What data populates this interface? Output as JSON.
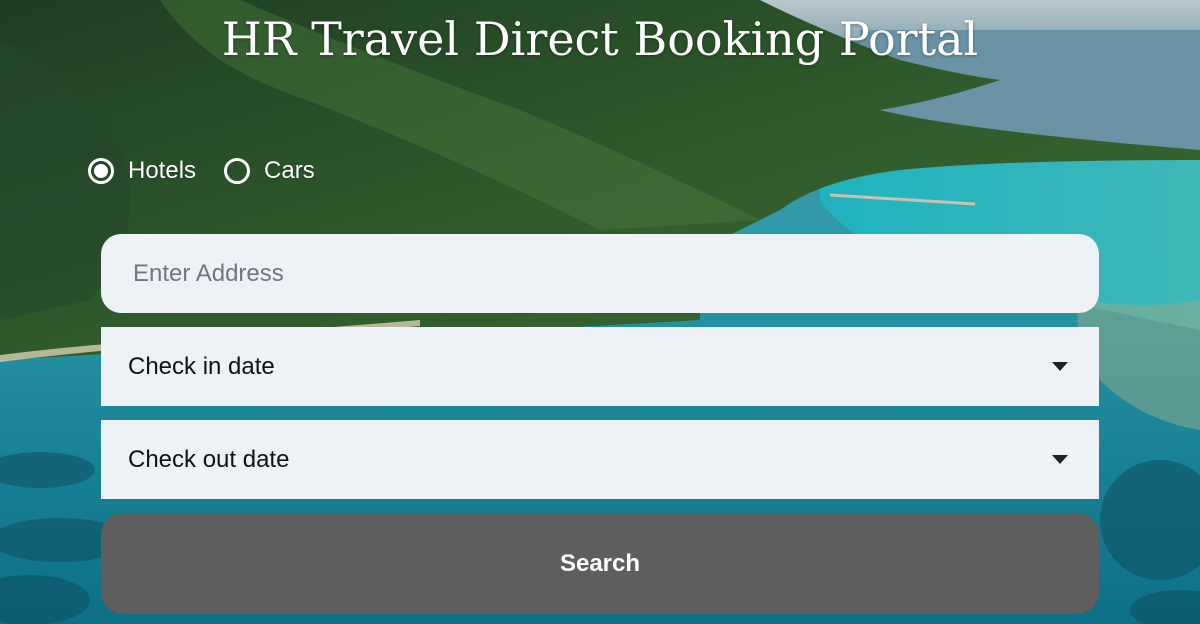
{
  "page": {
    "title": "HR Travel Direct Booking Portal"
  },
  "booking_type": {
    "options": [
      {
        "label": "Hotels",
        "selected": true
      },
      {
        "label": "Cars",
        "selected": false
      }
    ]
  },
  "form": {
    "address_placeholder": "Enter Address",
    "address_value": "",
    "checkin_label": "Check in date",
    "checkout_label": "Check out date",
    "search_label": "Search"
  },
  "colors": {
    "field_bg": "#eef2f6",
    "button_bg": "#5e5e5e",
    "text_on_image": "#ffffff"
  },
  "icons": {
    "checkin_caret": "caret-down-icon",
    "checkout_caret": "caret-down-icon"
  }
}
